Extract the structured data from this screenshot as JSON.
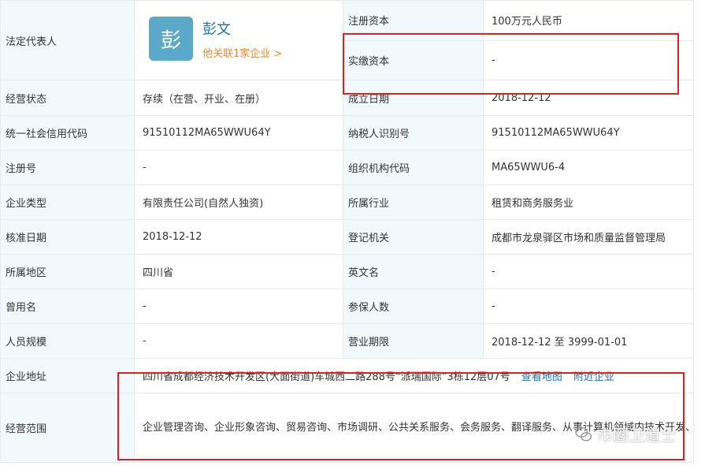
{
  "legal_rep": {
    "label": "法定代表人",
    "avatar_char": "彭",
    "name": "彭文",
    "related_link": "他关联1家企业 >"
  },
  "rows": [
    {
      "label1": "注册资本",
      "value1": "100万元人民币"
    },
    {
      "label1": "实缴资本",
      "value1": "-"
    },
    {
      "label1": "经营状态",
      "value1": "存续（在营、开业、在册）",
      "label2": "成立日期",
      "value2": "2018-12-12"
    },
    {
      "label1": "统一社会信用代码",
      "value1": "91510112MA65WWU64Y",
      "label2": "纳税人识别号",
      "value2": "91510112MA65WWU64Y"
    },
    {
      "label1": "注册号",
      "value1": "-",
      "label2": "组织机构代码",
      "value2": "MA65WWU6-4"
    },
    {
      "label1": "企业类型",
      "value1": "有限责任公司(自然人独资)",
      "label2": "所属行业",
      "value2": "租赁和商务服务业"
    },
    {
      "label1": "核准日期",
      "value1": "2018-12-12",
      "label2": "登记机关",
      "value2": "成都市龙泉驿区市场和质量监督管理局"
    },
    {
      "label1": "所属地区",
      "value1": "四川省",
      "label2": "英文名",
      "value2": "-"
    },
    {
      "label1": "曾用名",
      "value1": "-",
      "label2": "参保人数",
      "value2": "-"
    },
    {
      "label1": "人员规模",
      "value1": "-",
      "label2": "营业期限",
      "value2": "2018-12-12 至 3999-01-01"
    }
  ],
  "address": {
    "label": "企业地址",
    "value": "四川省成都经济技术开发区(大面街道)车城西二路288号“派瑞国际”3栋12层07号",
    "map_link": "查看地图",
    "nearby_link": "附近企业"
  },
  "scope": {
    "label": "经营范围",
    "value": "企业管理咨询、企业形象咨询、贸易咨询、市场调研、公共关系服务、会务服务、翻译服务、从事计算机领域内技术开发、技术咨询、技术服务(依法须经批准的项目,经相关部门批准后方可开展经营活动,未取得相关行政许可(审批),不得开展经营活动)。"
  },
  "watermark": {
    "text": "市圈卫道士"
  },
  "colors": {
    "label_bg": "#f2f9fc",
    "border": "#e4eaf0",
    "link_blue": "#1b6fb5",
    "link_orange": "#f0872a",
    "highlight_red": "#e0201e",
    "avatar_bg": "#5aa9c9"
  }
}
